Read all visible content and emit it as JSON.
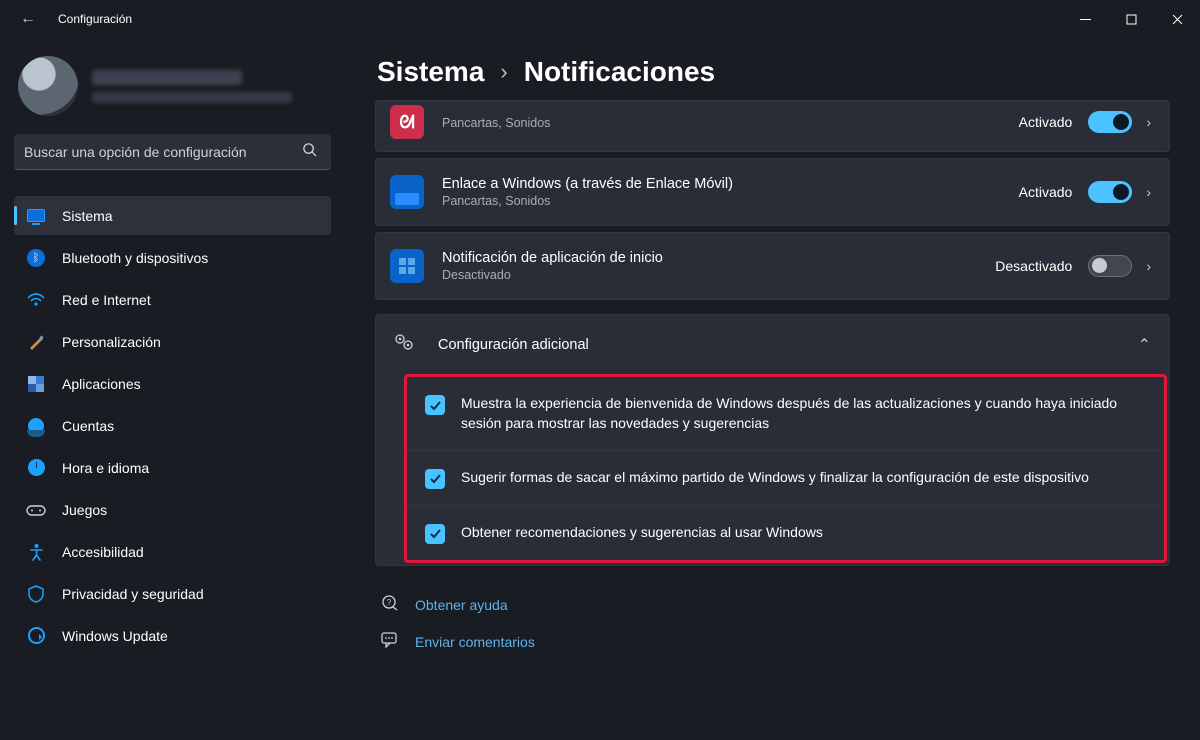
{
  "titlebar": {
    "title": "Configuración"
  },
  "search": {
    "placeholder": "Buscar una opción de configuración"
  },
  "nav": {
    "system": "Sistema",
    "bluetooth": "Bluetooth y dispositivos",
    "network": "Red e Internet",
    "personalization": "Personalización",
    "apps": "Aplicaciones",
    "accounts": "Cuentas",
    "time": "Hora e idioma",
    "gaming": "Juegos",
    "accessibility": "Accesibilidad",
    "privacy": "Privacidad y seguridad",
    "update": "Windows Update"
  },
  "breadcrumb": {
    "root": "Sistema",
    "page": "Notificaciones"
  },
  "apps": [
    {
      "subtitle": "Pancartas, Sonidos",
      "state": "Activado",
      "on": true
    },
    {
      "title": "Enlace a Windows (a través de Enlace Móvil)",
      "subtitle": "Pancartas, Sonidos",
      "state": "Activado",
      "on": true
    },
    {
      "title": "Notificación de aplicación de inicio",
      "subtitle": "Desactivado",
      "state": "Desactivado",
      "on": false
    }
  ],
  "section": {
    "title": "Configuración adicional"
  },
  "checks": [
    "Muestra la experiencia de bienvenida de Windows después de las actualizaciones y cuando haya iniciado sesión para mostrar las novedades y sugerencias",
    "Sugerir formas de sacar el máximo partido de Windows y finalizar la configuración de este dispositivo",
    "Obtener recomendaciones y sugerencias al usar Windows"
  ],
  "footer": {
    "help": "Obtener ayuda",
    "feedback": "Enviar comentarios"
  }
}
